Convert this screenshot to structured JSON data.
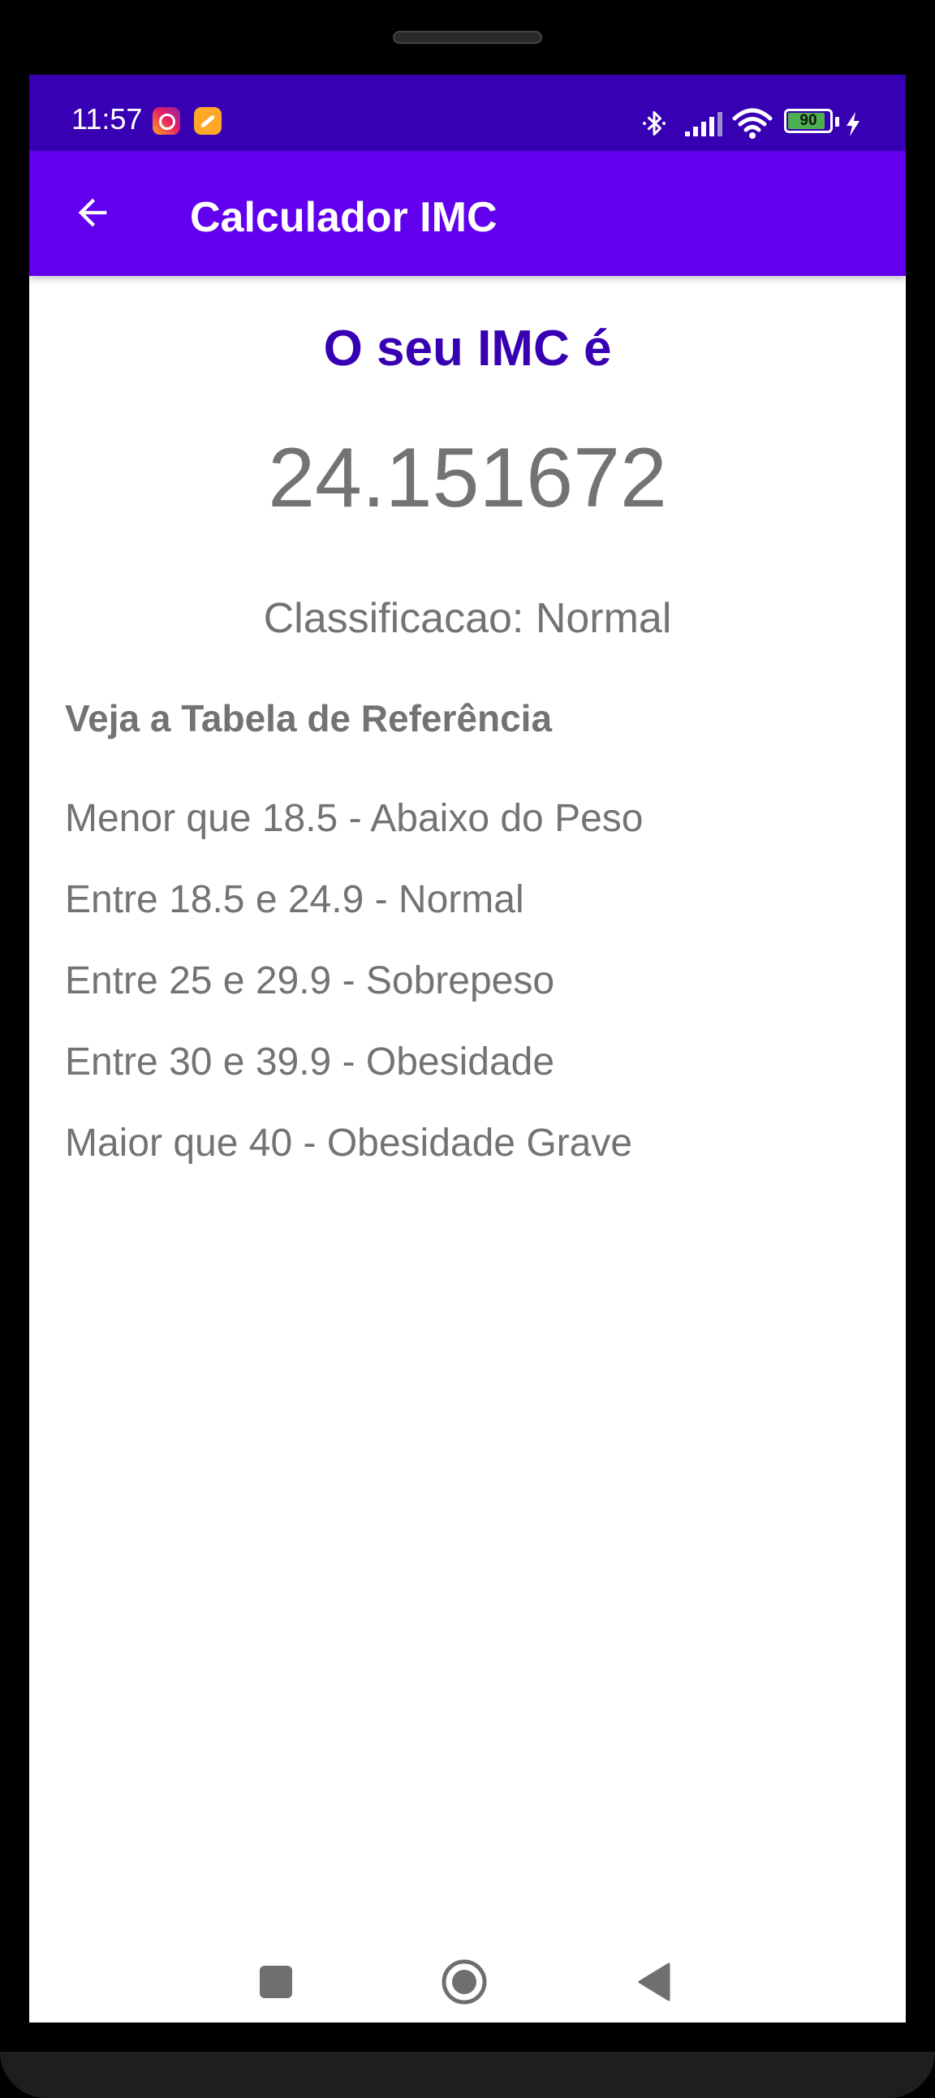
{
  "status_bar": {
    "time": "11:57",
    "battery_level": "90",
    "battery_fraction": 0.9,
    "icons": [
      "instagram-icon",
      "feed-icon",
      "bluetooth-icon",
      "signal-icon",
      "wifi-icon",
      "battery-icon",
      "charging-icon"
    ]
  },
  "app_bar": {
    "title": "Calculador IMC",
    "back_icon": "arrow-back-icon"
  },
  "result": {
    "heading": "O seu IMC é",
    "value": "24.151672",
    "classification": "Classificacao: Normal"
  },
  "reference": {
    "title": "Veja a Tabela de Referência",
    "items": [
      "Menor que 18.5 - Abaixo do Peso",
      "Entre 18.5 e 24.9 - Normal",
      "Entre 25 e 29.9 - Sobrepeso",
      "Entre 30 e 39.9 - Obesidade",
      "Maior que 40 - Obesidade Grave"
    ]
  },
  "navigation": {
    "buttons": [
      "recent-apps-icon",
      "home-icon",
      "back-triangle-icon"
    ]
  },
  "colors": {
    "status_bar": "#3700b3",
    "app_bar": "#6200ee",
    "heading": "#3700b3",
    "text_gray": "#737373"
  }
}
